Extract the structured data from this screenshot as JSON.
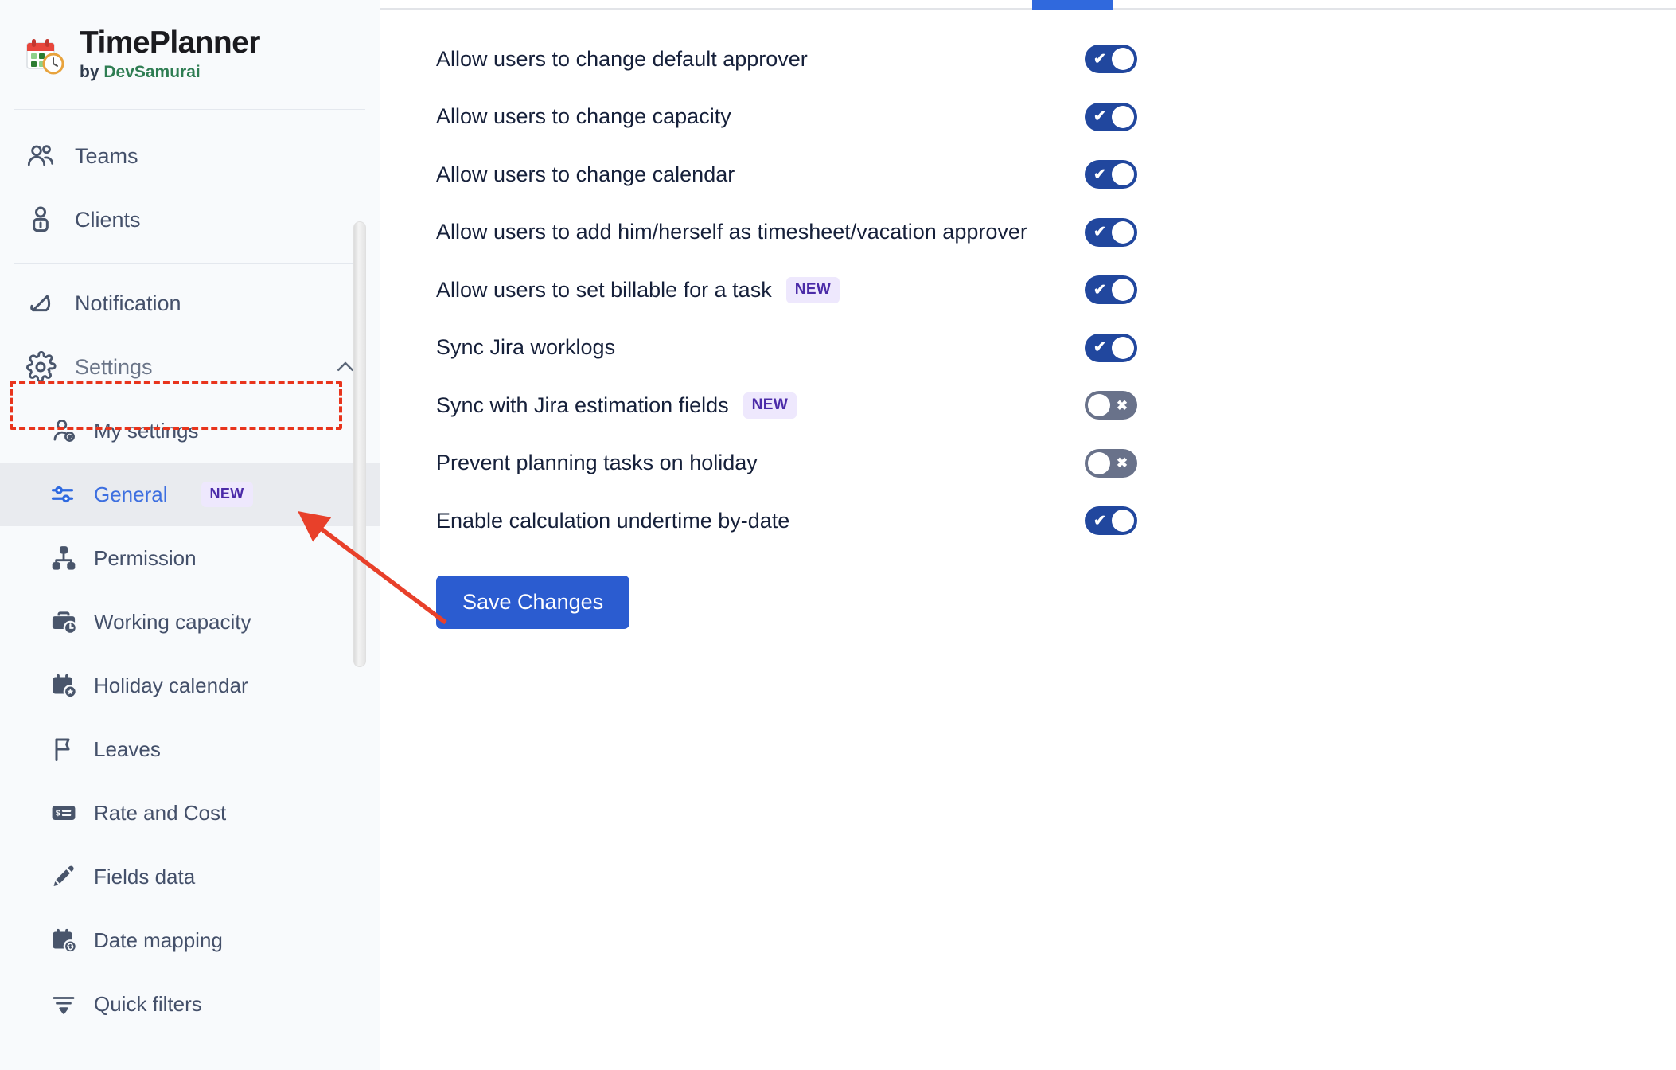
{
  "brand": {
    "logo_icon": "calendar-clock-icon",
    "title": "TimePlanner",
    "by_prefix": "by ",
    "vendor": "DevSamurai"
  },
  "sidebar": {
    "top_items": [
      {
        "icon": "users-group-icon",
        "label": "Teams"
      },
      {
        "icon": "user-lock-icon",
        "label": "Clients"
      }
    ],
    "main_items": [
      {
        "icon": "bell-icon",
        "label": "Notification"
      }
    ],
    "settings": {
      "icon": "gear-icon",
      "label": "Settings",
      "chevron": "chevron-up-icon",
      "expanded": true
    },
    "sub_items": [
      {
        "icon": "user-settings-icon",
        "label": "My settings",
        "active": false,
        "badge": ""
      },
      {
        "icon": "sliders-icon",
        "label": "General",
        "active": true,
        "badge": "NEW"
      },
      {
        "icon": "org-chart-icon",
        "label": "Permission",
        "active": false,
        "badge": ""
      },
      {
        "icon": "briefcase-clock-icon",
        "label": "Working capacity",
        "active": false,
        "badge": ""
      },
      {
        "icon": "calendar-star-icon",
        "label": "Holiday calendar",
        "active": false,
        "badge": ""
      },
      {
        "icon": "flag-icon",
        "label": "Leaves",
        "active": false,
        "badge": ""
      },
      {
        "icon": "money-card-icon",
        "label": "Rate and Cost",
        "active": false,
        "badge": ""
      },
      {
        "icon": "pencil-icon",
        "label": "Fields data",
        "active": false,
        "badge": ""
      },
      {
        "icon": "calendar-link-icon",
        "label": "Date mapping",
        "active": false,
        "badge": ""
      },
      {
        "icon": "funnel-icon",
        "label": "Quick filters",
        "active": false,
        "badge": ""
      }
    ]
  },
  "main": {
    "settings": [
      {
        "label": "Allow users to change default approver",
        "badge": "",
        "state": "on"
      },
      {
        "label": "Allow users to change capacity",
        "badge": "",
        "state": "on"
      },
      {
        "label": "Allow users to change calendar",
        "badge": "",
        "state": "on"
      },
      {
        "label": "Allow users to add him/herself as timesheet/vacation approver",
        "badge": "",
        "state": "on"
      },
      {
        "label": "Allow users to set billable for a task",
        "badge": "NEW",
        "state": "on"
      },
      {
        "label": "Sync Jira worklogs",
        "badge": "",
        "state": "on"
      },
      {
        "label": "Sync with Jira estimation fields",
        "badge": "NEW",
        "state": "off"
      },
      {
        "label": "Prevent planning tasks on holiday",
        "badge": "",
        "state": "off"
      },
      {
        "label": "Enable calculation undertime by-date",
        "badge": "",
        "state": "on"
      }
    ],
    "save_label": "Save Changes"
  },
  "annotations": {
    "highlight_target": "Settings",
    "arrow_target": "General",
    "color": "#e8341c"
  },
  "colors": {
    "accent_blue": "#2b5cd0",
    "toggle_on": "#21479e",
    "toggle_off": "#69728a",
    "badge_bg": "#eee8fd",
    "badge_text": "#4b2ba8",
    "sidebar_bg": "#f8fafc",
    "active_item_bg": "#e9ebef",
    "vendor_green": "#2e7d52"
  }
}
